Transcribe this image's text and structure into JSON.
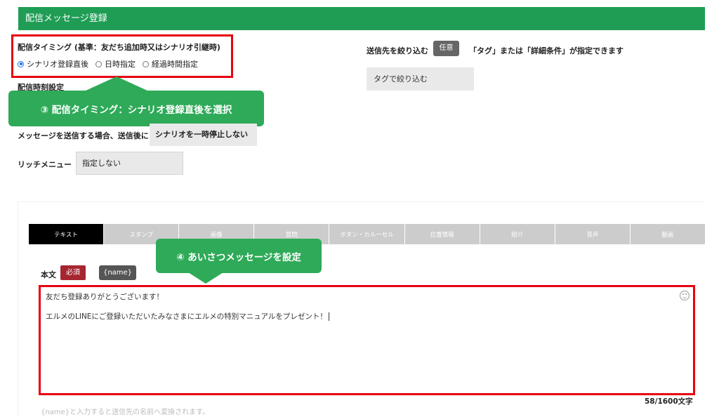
{
  "header": {
    "title": "配信メッセージ登録"
  },
  "timing": {
    "label": "配信タイミング (基準：友だち追加時又はシナリオ引継時)",
    "options": [
      {
        "label": "シナリオ登録直後",
        "selected": true
      },
      {
        "label": "日時指定",
        "selected": false
      },
      {
        "label": "経過時間指定",
        "selected": false
      }
    ]
  },
  "time_setting": {
    "label": "配信時刻設定"
  },
  "callouts": {
    "step3": "③ 配信タイミング：シナリオ登録直後を選択",
    "step4": "④ あいさつメッセージを設定"
  },
  "send_after": {
    "label": "メッセージを送信する場合、送信後に",
    "value": "シナリオを一時停止しない"
  },
  "rich_menu": {
    "label": "リッチメニュー",
    "value": "指定しない"
  },
  "narrow": {
    "label": "送信先を絞り込む",
    "badge": "任意",
    "note": "「タグ」または「詳細条件」が指定できます",
    "tag_button": "タグで絞り込む"
  },
  "tabs": [
    {
      "label": "テキスト",
      "active": true
    },
    {
      "label": "スタンプ",
      "active": false
    },
    {
      "label": "画像",
      "active": false
    },
    {
      "label": "質問",
      "active": false
    },
    {
      "label": "ボタン・カルーセル",
      "active": false
    },
    {
      "label": "位置情報",
      "active": false
    },
    {
      "label": "紹介",
      "active": false
    },
    {
      "label": "音声",
      "active": false
    },
    {
      "label": "動画",
      "active": false
    }
  ],
  "body": {
    "label": "本文",
    "required": "必須",
    "name_tag": "{name}",
    "line1": "友だち登録ありがとうございます！",
    "line2": "エルメのLINEにご登録いただいたみなさまにエルメの特別マニュアルをプレゼント！",
    "char_count": "58/1600文字",
    "hint": "{name}と入力すると送信先の名前へ変換されます。"
  },
  "colors": {
    "brand_green": "#1f9d55",
    "highlight_red": "#e60012",
    "callout_green": "#2eaa58"
  }
}
